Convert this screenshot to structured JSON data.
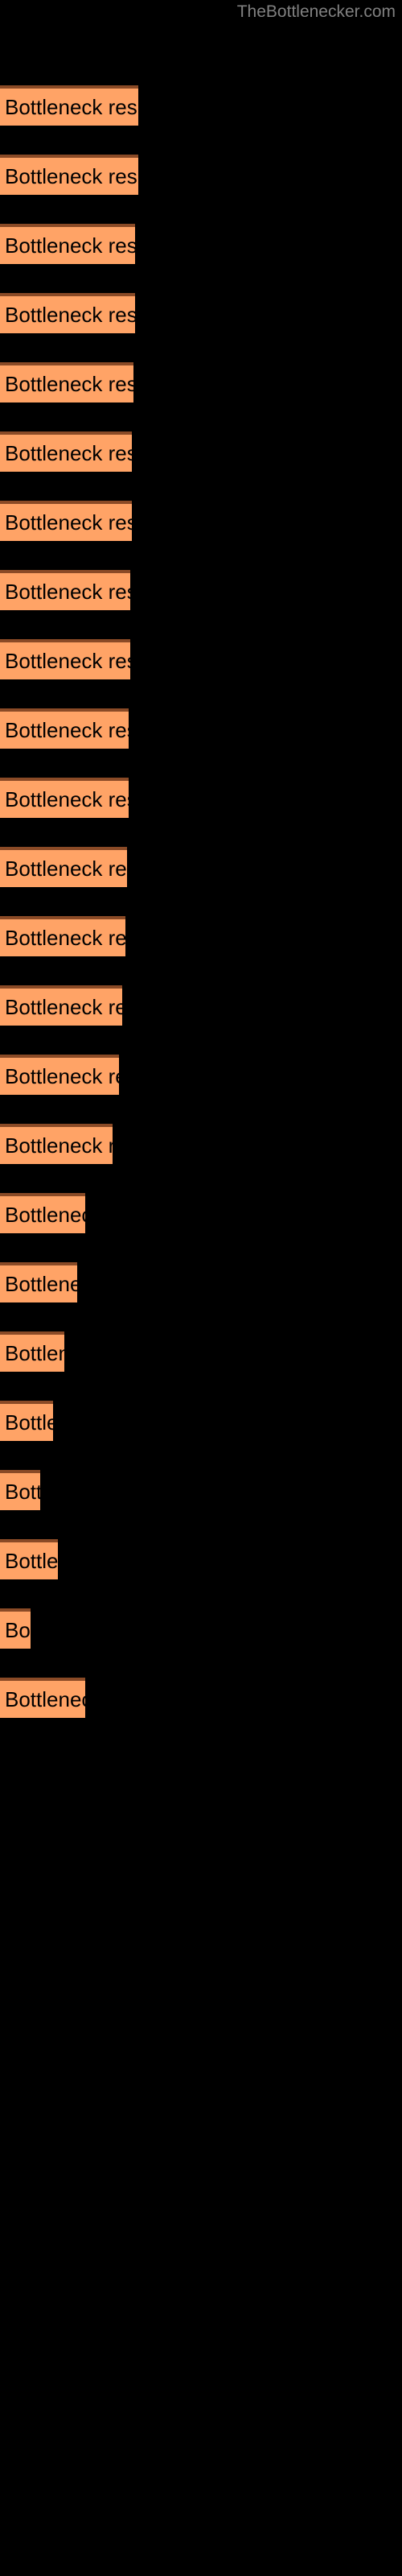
{
  "site": {
    "title": "TheBottlenecker.com",
    "title_color": "#808080",
    "background_color": "#000000"
  },
  "chart_data": {
    "type": "bar",
    "orientation": "horizontal",
    "title": "TheBottlenecker.com",
    "xlabel": "",
    "ylabel": "",
    "grid": false,
    "legend": false,
    "bar_color": "#ffa366",
    "bar_border_color": "#8a4a26",
    "label_color": "#000000",
    "bar_label_text": "Bottleneck result",
    "xlim": [
      0,
      500
    ],
    "categories": [
      "Bottleneck result",
      "Bottleneck result",
      "Bottleneck result",
      "Bottleneck result",
      "Bottleneck result",
      "Bottleneck result",
      "Bottleneck result",
      "Bottleneck result",
      "Bottleneck result",
      "Bottleneck result",
      "Bottleneck result",
      "Bottleneck result",
      "Bottleneck result",
      "Bottleneck result",
      "Bottleneck result",
      "Bottleneck result",
      "Bottleneck result",
      "Bottleneck result",
      "Bottleneck result",
      "Bottleneck result",
      "Bottleneck result",
      "Bottleneck result",
      "Bottleneck result",
      "Bottleneck result"
    ],
    "values": [
      86,
      86,
      84,
      84,
      83,
      82,
      82,
      81,
      81,
      80,
      80,
      79,
      78,
      76,
      74,
      70,
      53,
      48,
      40,
      33,
      25,
      36,
      19,
      53
    ],
    "bars": [
      {
        "index": 1,
        "label": "Bottleneck result",
        "width": 86,
        "y": 53
      },
      {
        "index": 2,
        "label": "Bottleneck result",
        "width": 86,
        "y": 96
      },
      {
        "index": 3,
        "label": "Bottleneck result",
        "width": 84,
        "y": 139
      },
      {
        "index": 4,
        "label": "Bottleneck result",
        "width": 84,
        "y": 182
      },
      {
        "index": 5,
        "label": "Bottleneck result",
        "width": 83,
        "y": 225
      },
      {
        "index": 6,
        "label": "Bottleneck result",
        "width": 82,
        "y": 268
      },
      {
        "index": 7,
        "label": "Bottleneck result",
        "width": 82,
        "y": 311
      },
      {
        "index": 8,
        "label": "Bottleneck result",
        "width": 81,
        "y": 354
      },
      {
        "index": 9,
        "label": "Bottleneck result",
        "width": 81,
        "y": 397
      },
      {
        "index": 10,
        "label": "Bottleneck result",
        "width": 80,
        "y": 440
      },
      {
        "index": 11,
        "label": "Bottleneck result",
        "width": 80,
        "y": 483
      },
      {
        "index": 12,
        "label": "Bottleneck result",
        "width": 79,
        "y": 526
      },
      {
        "index": 13,
        "label": "Bottleneck result",
        "width": 78,
        "y": 569
      },
      {
        "index": 14,
        "label": "Bottleneck result",
        "width": 76,
        "y": 612
      },
      {
        "index": 15,
        "label": "Bottleneck result",
        "width": 74,
        "y": 655
      },
      {
        "index": 16,
        "label": "Bottleneck result",
        "width": 70,
        "y": 698
      },
      {
        "index": 17,
        "label": "Bottleneck result",
        "width": 53,
        "y": 741
      },
      {
        "index": 18,
        "label": "Bottleneck result",
        "width": 48,
        "y": 784
      },
      {
        "index": 19,
        "label": "Bottleneck result",
        "width": 40,
        "y": 827
      },
      {
        "index": 20,
        "label": "Bottleneck result",
        "width": 33,
        "y": 870
      },
      {
        "index": 21,
        "label": "Bottleneck result",
        "width": 25,
        "y": 913
      },
      {
        "index": 22,
        "label": "Bottleneck result",
        "width": 36,
        "y": 956
      },
      {
        "index": 23,
        "label": "Bottleneck result",
        "width": 19,
        "y": 999
      },
      {
        "index": 24,
        "label": "Bottleneck result",
        "width": 53,
        "y": 1042
      }
    ]
  }
}
